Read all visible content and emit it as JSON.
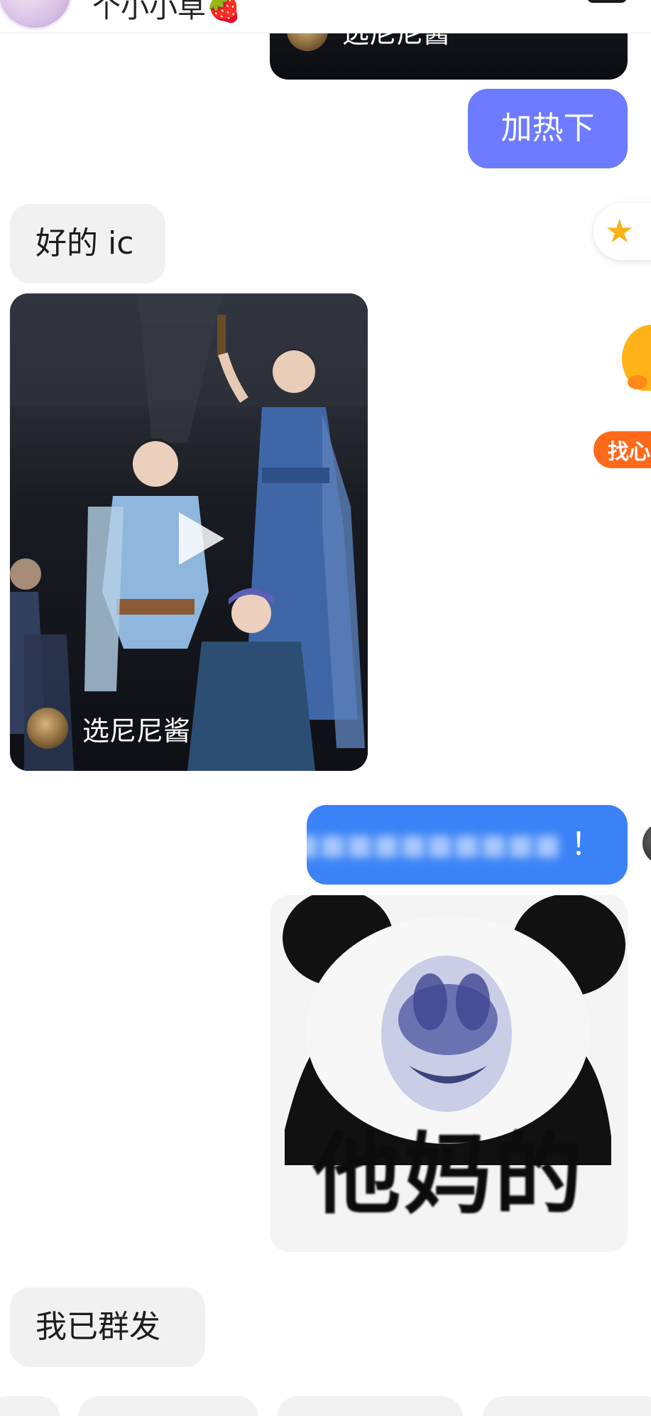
{
  "header": {
    "title": "个小小草",
    "title_emoji": "🍓"
  },
  "messages": [
    {
      "id": "video_top",
      "type": "video",
      "side": "right",
      "uploader": "选尼尼酱"
    },
    {
      "id": "msg_heat",
      "type": "text",
      "side": "right",
      "text": "加热下"
    },
    {
      "id": "msg_ok",
      "type": "text",
      "side": "left",
      "text": "好的 ic"
    },
    {
      "id": "video_main",
      "type": "video",
      "side": "left",
      "uploader": "选尼尼酱"
    },
    {
      "id": "msg_blurred",
      "type": "text",
      "side": "right",
      "text": "！"
    },
    {
      "id": "meme",
      "type": "sticker",
      "side": "right",
      "caption": "他妈的"
    },
    {
      "id": "msg_sent",
      "type": "text",
      "side": "left",
      "text": "我已群发"
    }
  ],
  "edge_widgets": {
    "star_icon": "star-icon",
    "orange_button_label": "找心"
  },
  "colors": {
    "purple_bubble": "#6c7bff",
    "blue_bubble": "#3b82f6",
    "incoming_bubble": "#f1f1f1",
    "orange_accent": "#ff6a1a"
  }
}
